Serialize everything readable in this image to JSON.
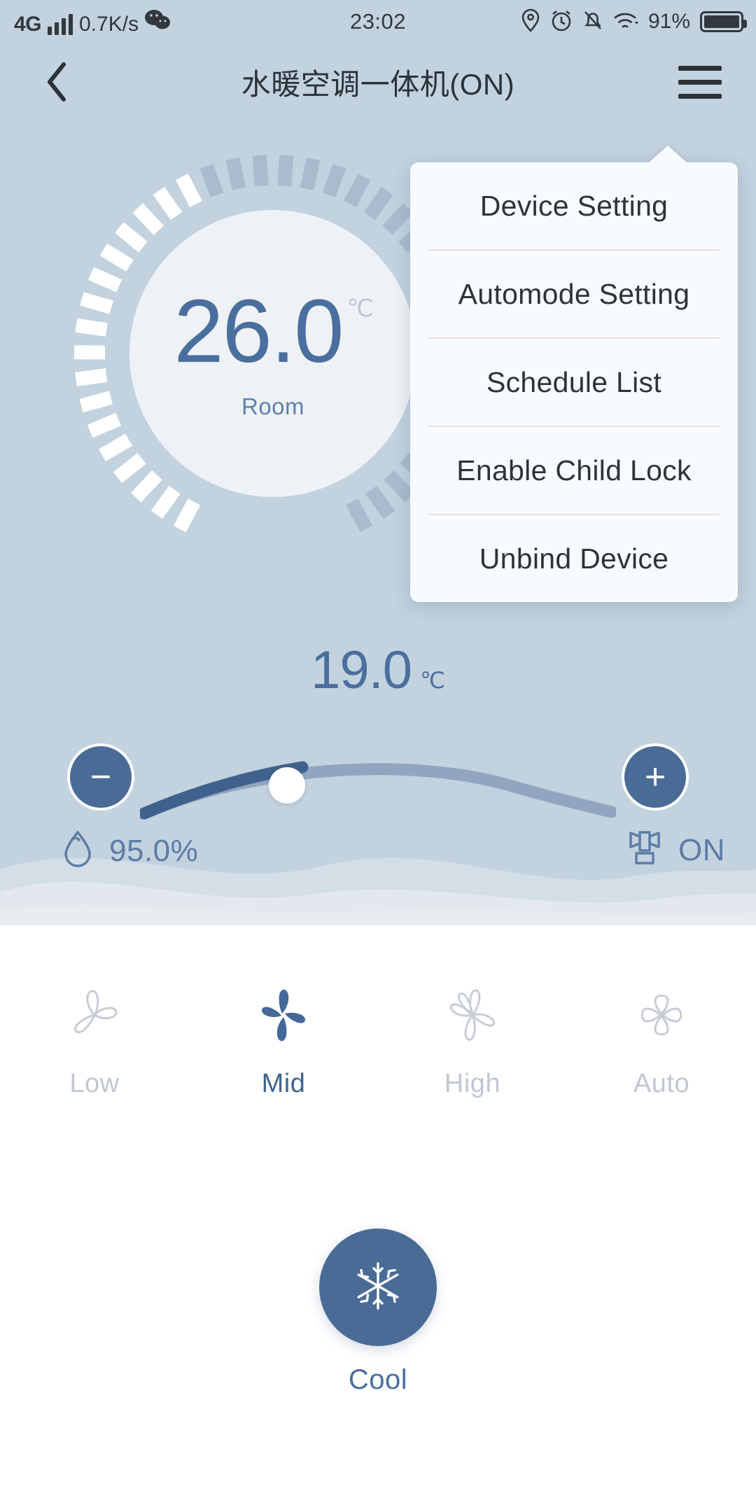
{
  "statusbar": {
    "network_type": "4G",
    "signal_icon": "signal-bars-icon",
    "net_speed": "0.7K/s",
    "app_badge_icon": "wechat-icon",
    "time": "23:02",
    "location_icon": "location-pin-icon",
    "alarm_icon": "alarm-clock-icon",
    "mute_icon": "bell-muted-icon",
    "wifi_icon": "wifi-icon",
    "battery_percent": "91%",
    "battery_icon": "battery-full-icon"
  },
  "header": {
    "back_icon": "back-chevron-icon",
    "title": "水暖空调一体机(ON)",
    "menu_icon": "hamburger-menu-icon"
  },
  "menu": {
    "items": [
      {
        "label": "Device Setting",
        "name": "menu-item-device-setting"
      },
      {
        "label": "Automode Setting",
        "name": "menu-item-automode-setting"
      },
      {
        "label": "Schedule List",
        "name": "menu-item-schedule-list"
      },
      {
        "label": "Enable Child Lock",
        "name": "menu-item-enable-child-lock"
      },
      {
        "label": "Unbind Device",
        "name": "menu-item-unbind-device"
      }
    ]
  },
  "dial": {
    "room_temp": "26.0",
    "unit": "℃",
    "label": "Room",
    "total_ticks": 40,
    "active_ticks": 17
  },
  "set_temp": {
    "value": "19.0",
    "unit": "℃"
  },
  "slider": {
    "minus_label": "−",
    "plus_label": "+",
    "fill_percent": 32
  },
  "status": {
    "humidity_icon": "humidity-droplet-icon",
    "humidity_value": "95.0%",
    "power_icon": "valve-icon",
    "power_value": "ON"
  },
  "fan": {
    "items": [
      {
        "label": "Low",
        "icon": "fan-3-blade-icon",
        "active": false
      },
      {
        "label": "Mid",
        "icon": "fan-4-blade-icon",
        "active": true
      },
      {
        "label": "High",
        "icon": "fan-5-blade-icon",
        "active": false
      },
      {
        "label": "Auto",
        "icon": "fan-auto-icon",
        "active": false
      }
    ]
  },
  "mode": {
    "icon": "snowflake-icon",
    "label": "Cool"
  },
  "colors": {
    "panel_bg": "#c2d2de",
    "accent": "#4a6b96",
    "accent_text": "#4a6f9e",
    "inactive": "#c1c7d1",
    "menu_bg": "#f8fbfd",
    "dial_inner": "#eef2f6"
  }
}
